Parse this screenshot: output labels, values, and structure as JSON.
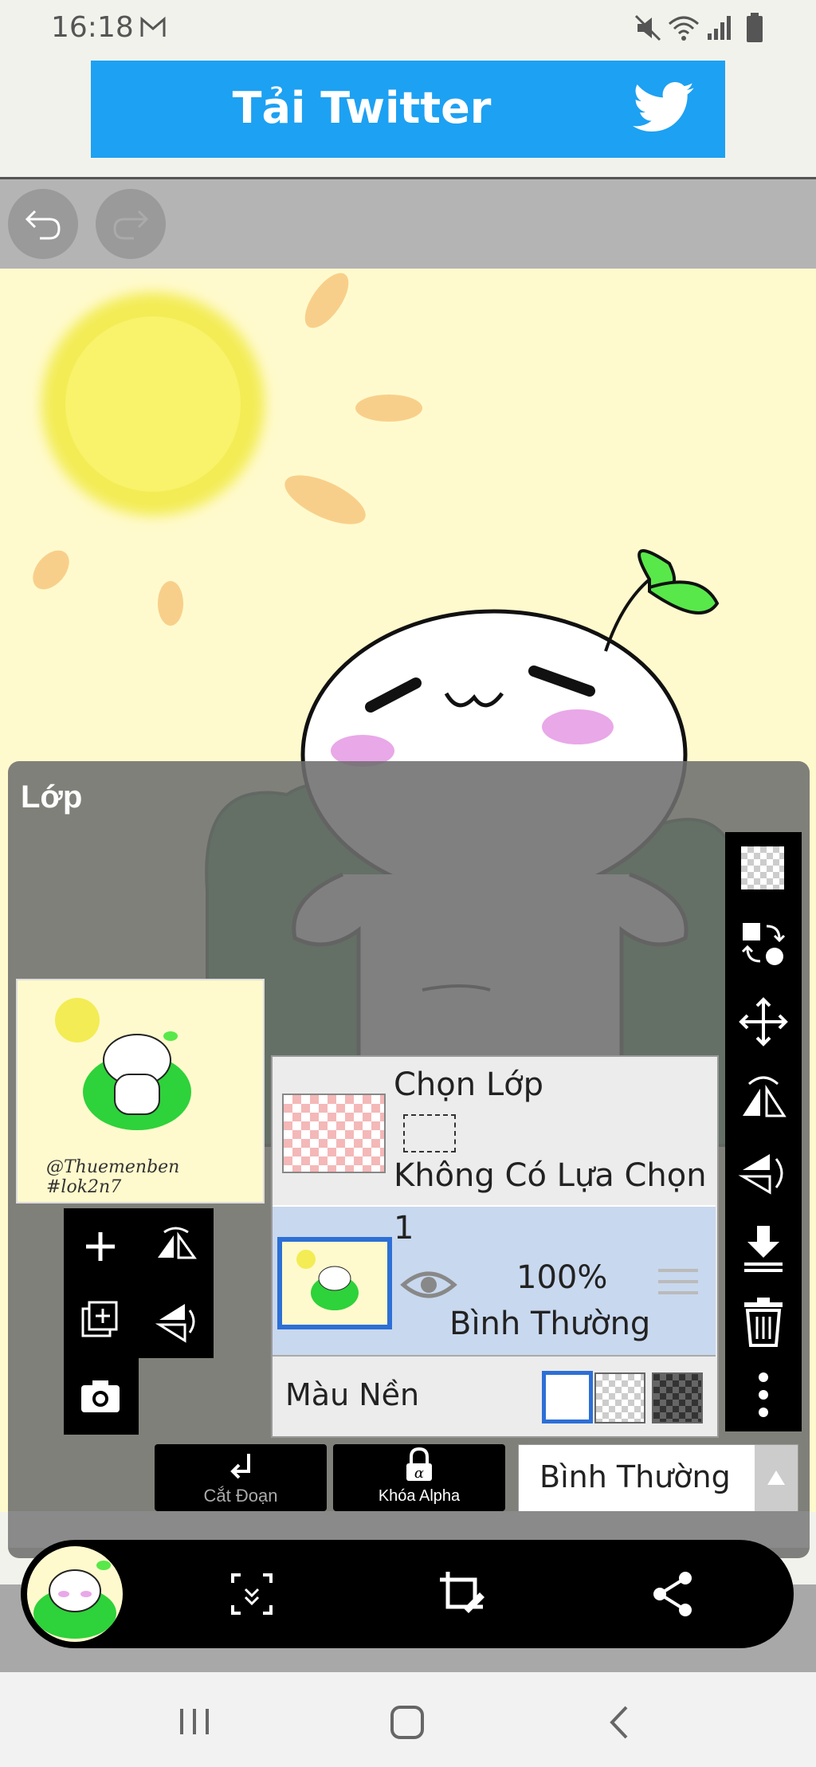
{
  "status_bar": {
    "time": "16:18"
  },
  "banner": {
    "text": "Tải Twitter"
  },
  "layer_panel": {
    "title": "Lớp",
    "selection": {
      "title": "Chọn Lớp",
      "status": "Không Có Lựa Chọn"
    },
    "layer": {
      "name": "1",
      "opacity": "100%",
      "blend": "Bình Thường"
    },
    "background": {
      "label": "Màu Nền"
    }
  },
  "blend_row": {
    "clip_label": "Cắt Đoạn",
    "alpha_lock_label": "Khóa Alpha",
    "blend_mode": "Bình Thường"
  },
  "thumbnail": {
    "caption": "@Thuemenben #lok2n7"
  },
  "colors": {
    "banner_blue": "#1da1f2",
    "canvas_bg": "#fffacd",
    "selected_blue": "#2d6fd6",
    "layer_row_bg": "#c8d8ee"
  },
  "icons": [
    "undo-icon",
    "redo-icon",
    "twitter-bird-icon",
    "add-layer-icon",
    "flip-horizontal-icon",
    "copy-layer-icon",
    "flip-vertical-icon",
    "camera-icon",
    "transparency-icon",
    "swap-icon",
    "move-icon",
    "rotate-icon",
    "merge-down-icon",
    "trash-icon",
    "more-icon",
    "eye-icon",
    "drag-handle-icon",
    "crop-icon",
    "share-icon",
    "expand-icon"
  ]
}
